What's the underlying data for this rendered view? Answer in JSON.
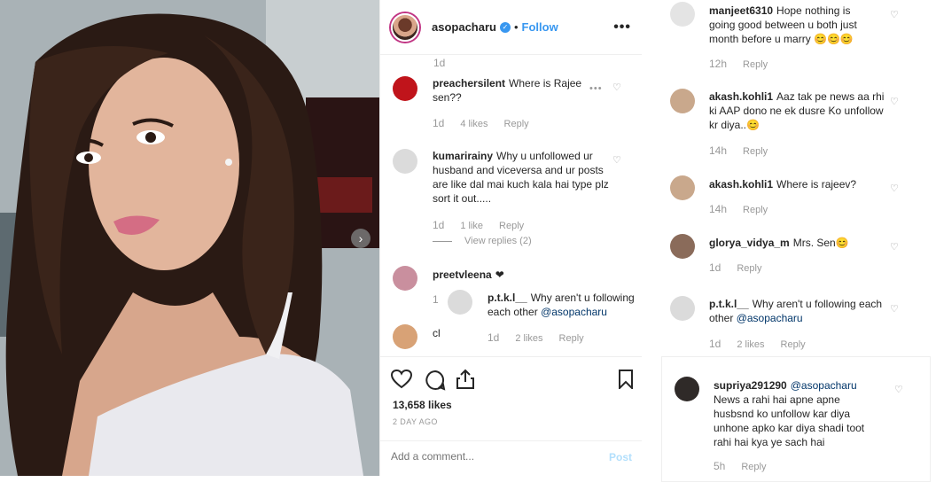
{
  "post": {
    "username": "asopacharu",
    "separator": "•",
    "follow_label": "Follow",
    "more_label": "•••",
    "likes": "13,658 likes",
    "time_ago": "2 DAY AGO",
    "add_comment_placeholder": "Add a comment...",
    "post_label": "Post",
    "next_label": "›",
    "verified_label": "✓"
  },
  "comments": [
    {
      "id": "c0",
      "time": "1d"
    },
    {
      "id": "c1",
      "user": "preachersilent",
      "text": "Where is Rajee sen??",
      "time": "1d",
      "likes": "4 likes",
      "reply": "Reply"
    },
    {
      "id": "c2",
      "user": "kumarirainy",
      "text": "Why u unfollowed ur husband and viceversa and ur posts are like dal mai kuch kala hai type plz sort it out.....",
      "time": "1d",
      "likes": "1 like",
      "reply": "Reply",
      "view_replies": "View replies (2)"
    },
    {
      "id": "c3",
      "user": "preetvleena",
      "text": "❤",
      "reply_user": "p.t.k.l__",
      "reply_text": "Why aren't u following each other",
      "reply_mention": "@asopacharu",
      "reply_count": "1",
      "reply_time": "1d",
      "reply_likes": "2 likes",
      "reply_reply": "Reply"
    },
    {
      "id": "c4",
      "text": "cl"
    }
  ],
  "right_comments": [
    {
      "user": "manjeet6310",
      "text": "Hope nothing is going good between u both just month before u marry 😊😊😊",
      "time": "12h",
      "reply": "Reply"
    },
    {
      "user": "akash.kohli1",
      "text": "Aaz tak pe news aa rhi ki AAP dono ne ek dusre Ko unfollow kr diya..😊",
      "time": "14h",
      "reply": "Reply"
    },
    {
      "user": "akash.kohli1",
      "text": "Where is rajeev?",
      "time": "14h",
      "reply": "Reply"
    },
    {
      "user": "glorya_vidya_m",
      "text": "Mrs. Sen😊",
      "time": "1d",
      "reply": "Reply"
    },
    {
      "user": "p.t.k.l__",
      "text": "Why aren't u following each other",
      "mention": "@asopacharu",
      "time": "1d",
      "likes": "2 likes",
      "reply": "Reply"
    },
    {
      "user": "supriya291290",
      "mention": "@asopacharu",
      "text": "News a rahi hai apne apne husbsnd ko unfollow kar diya unhone apko kar diya shadi toot rahi hai kya ye sach hai",
      "time": "5h",
      "reply": "Reply"
    }
  ],
  "icons": {
    "heart": "♡",
    "options": "•••"
  },
  "colors": {
    "accent": "#3897f0",
    "muted": "#999999",
    "text": "#262626",
    "border": "#efefef"
  }
}
